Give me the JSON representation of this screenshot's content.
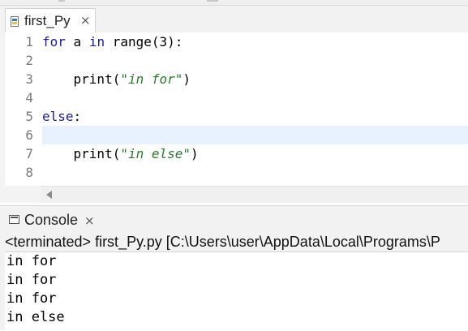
{
  "editor": {
    "tab": {
      "label": "first_Py",
      "close": "×"
    },
    "line_numbers": [
      "1",
      "2",
      "3",
      "4",
      "5",
      "6",
      "7",
      "8"
    ],
    "lines": [
      {
        "kw": "for",
        "a": " a ",
        "kw2": "in",
        "b": " range(",
        "num": "3",
        "c": "):"
      },
      {
        "text": ""
      },
      {
        "indent": "    ",
        "fn": "print",
        "p1": "(",
        "str": "\"in for\"",
        "p2": ")"
      },
      {
        "text": ""
      },
      {
        "kw": "else",
        "c": ":"
      },
      {
        "text": ""
      },
      {
        "indent": "    ",
        "fn": "print",
        "p1": "(",
        "str": "\"in else\"",
        "p2": ")"
      },
      {
        "text": ""
      }
    ],
    "current_line": 6
  },
  "console": {
    "tab": {
      "label": "Console",
      "close": "×"
    },
    "status": "<terminated> first_Py.py [C:\\Users\\user\\AppData\\Local\\Programs\\P",
    "output": [
      "in for",
      "in for",
      "in for",
      "in else"
    ]
  },
  "colors": {
    "keyword": "#1a1aa6",
    "string": "#2a7a2a",
    "current_line": "#e8f2fe"
  },
  "icons": {
    "editor_tab": "python-file-icon",
    "console_tab": "console-icon",
    "scroll_left": "scroll-left-arrow-icon"
  }
}
